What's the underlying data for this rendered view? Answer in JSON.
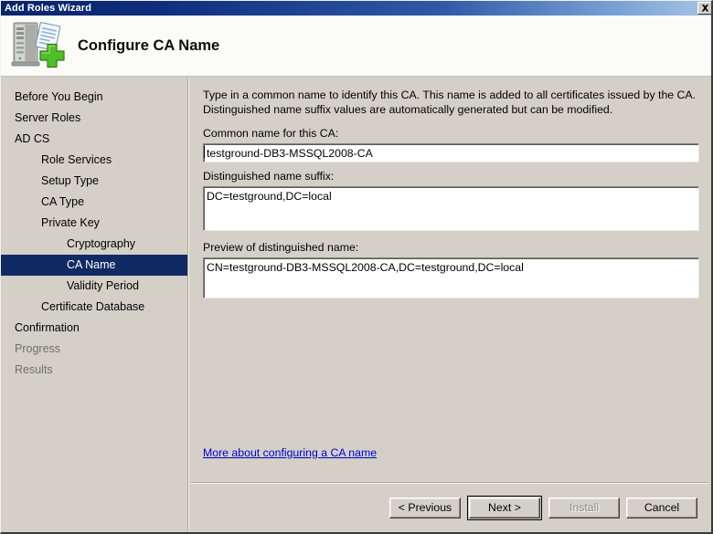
{
  "window": {
    "title": "Add Roles Wizard",
    "close_icon": "close-icon"
  },
  "header": {
    "title": "Configure CA Name",
    "icon": "server-add-role-icon"
  },
  "sidebar": {
    "items": [
      {
        "label": "Before You Begin",
        "level": 1,
        "state": "normal"
      },
      {
        "label": "Server Roles",
        "level": 1,
        "state": "normal"
      },
      {
        "label": "AD CS",
        "level": 1,
        "state": "normal"
      },
      {
        "label": "Role Services",
        "level": 2,
        "state": "normal"
      },
      {
        "label": "Setup Type",
        "level": 2,
        "state": "normal"
      },
      {
        "label": "CA Type",
        "level": 2,
        "state": "normal"
      },
      {
        "label": "Private Key",
        "level": 2,
        "state": "normal"
      },
      {
        "label": "Cryptography",
        "level": 3,
        "state": "normal"
      },
      {
        "label": "CA Name",
        "level": 3,
        "state": "selected"
      },
      {
        "label": "Validity Period",
        "level": 3,
        "state": "normal"
      },
      {
        "label": "Certificate Database",
        "level": 2,
        "state": "normal"
      },
      {
        "label": "Confirmation",
        "level": 1,
        "state": "normal"
      },
      {
        "label": "Progress",
        "level": 1,
        "state": "dim"
      },
      {
        "label": "Results",
        "level": 1,
        "state": "dim"
      }
    ]
  },
  "content": {
    "intro_line1": "Type in a common name to identify this CA. This name is added to all certificates issued by the CA.",
    "intro_line2": "Distinguished name suffix values are automatically generated but can be modified.",
    "common_name_label": "Common name for this CA:",
    "common_name_value": "testground-DB3-MSSQL2008-CA",
    "dn_suffix_label": "Distinguished name suffix:",
    "dn_suffix_value": "DC=testground,DC=local",
    "dn_preview_label": "Preview of distinguished name:",
    "dn_preview_value": "CN=testground-DB3-MSSQL2008-CA,DC=testground,DC=local",
    "help_link": "More about configuring a CA name"
  },
  "footer": {
    "previous_label": "< Previous",
    "next_label": "Next >",
    "install_label": "Install",
    "cancel_label": "Cancel"
  },
  "colors": {
    "titlebar_start": "#0a246a",
    "window_bg": "#d4d0c8",
    "selection": "#102a63",
    "link": "#0000cc",
    "disabled_text": "#8a8880"
  }
}
